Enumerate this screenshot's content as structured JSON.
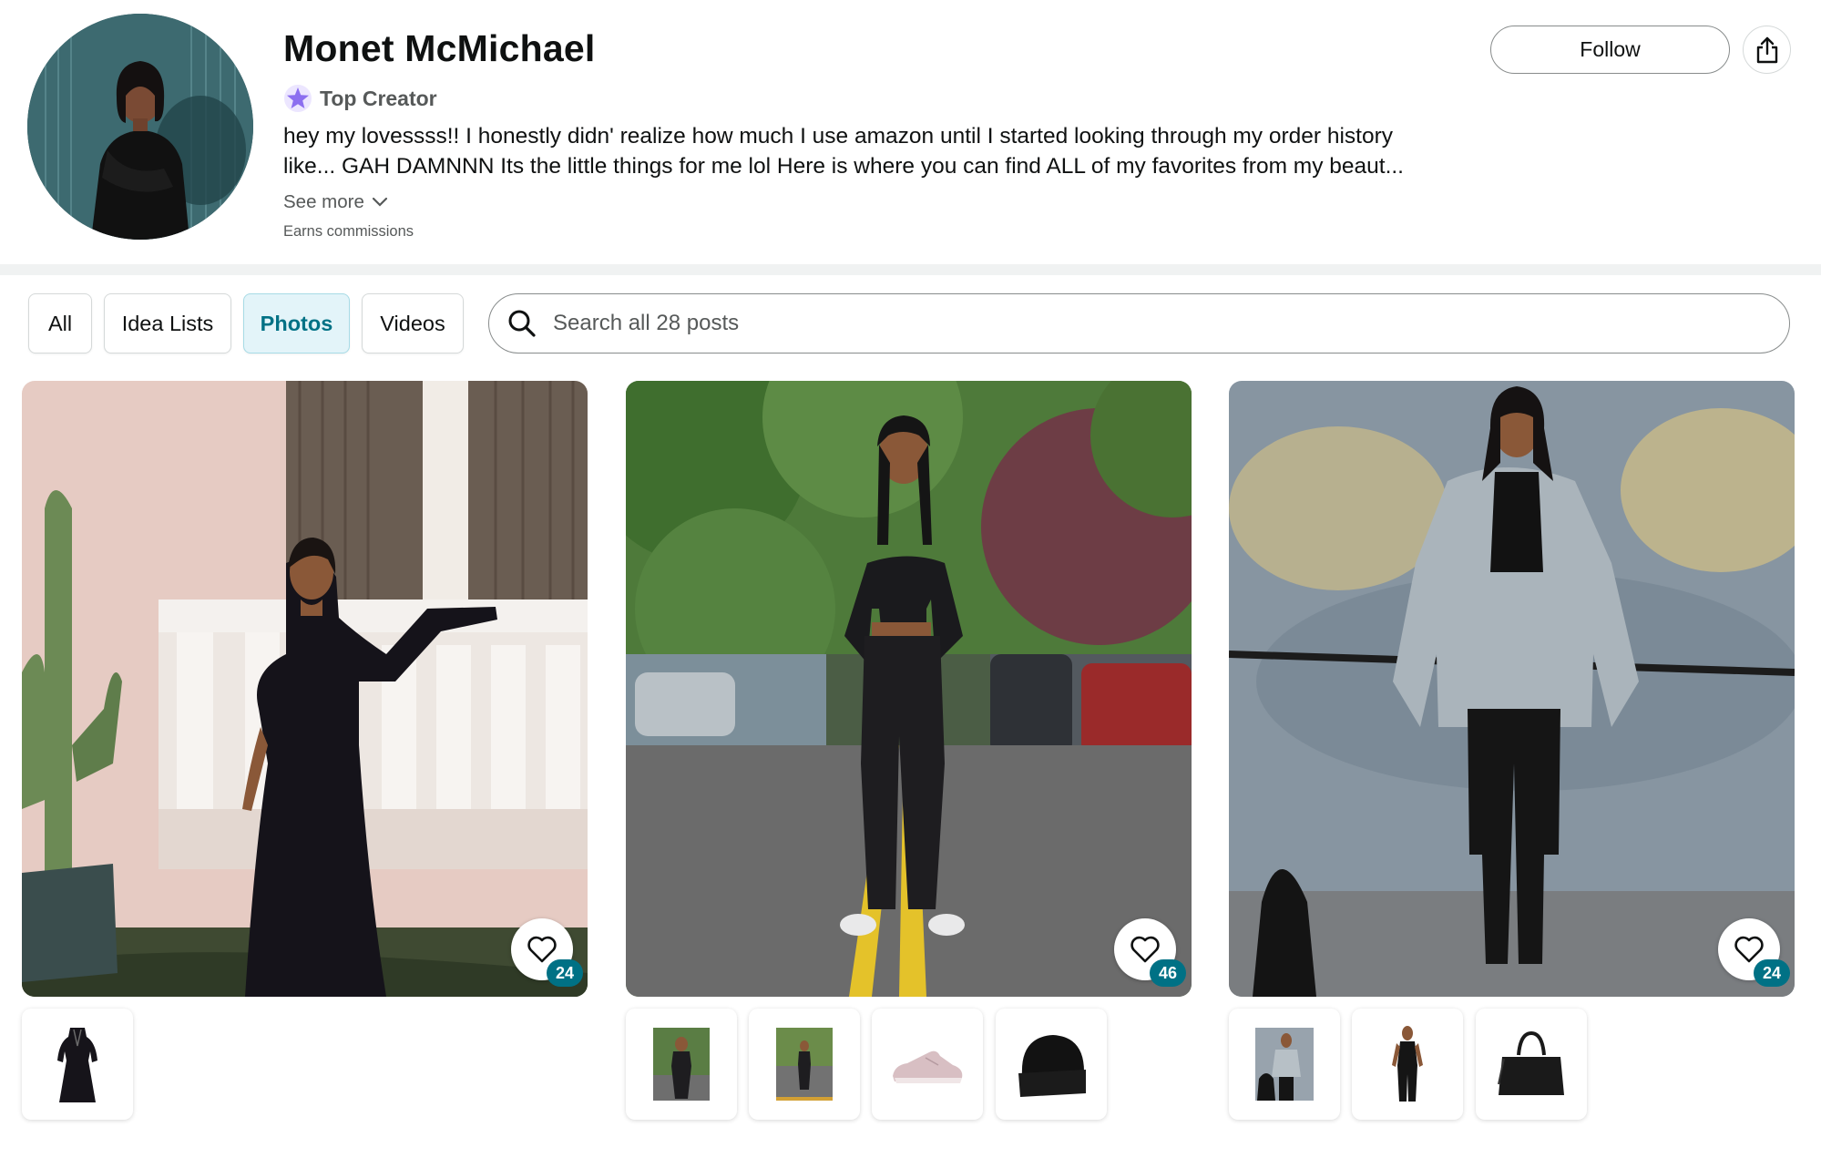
{
  "profile": {
    "name": "Monet McMichael",
    "badge": "Top Creator",
    "bio_line1": "hey my lovessss!! I honestly didn' realize how much I use amazon until I started looking through my order history",
    "bio_line2": "like... GAH DAMNNN Its the little things for me lol Here is where you can find ALL of my favorites from my beaut...",
    "see_more": "See more",
    "earns": "Earns commissions",
    "follow_label": "Follow",
    "avatar_icon": "profile-photo"
  },
  "filters": {
    "tabs": [
      {
        "label": "All",
        "active": false
      },
      {
        "label": "Idea Lists",
        "active": false
      },
      {
        "label": "Photos",
        "active": true
      },
      {
        "label": "Videos",
        "active": false
      }
    ],
    "search_placeholder": "Search all 28 posts"
  },
  "posts": [
    {
      "likes": "24",
      "thumbnails": [
        "black-dress"
      ]
    },
    {
      "likes": "46",
      "thumbnails": [
        "outfit-photo",
        "outfit-photo-street",
        "pink-sneaker",
        "black-beanie"
      ]
    },
    {
      "likes": "24",
      "thumbnails": [
        "outfit-photo-jacket",
        "black-jumpsuit",
        "black-tote-bag"
      ]
    }
  ],
  "colors": {
    "accent_teal": "#007185",
    "active_chip_bg": "#e3f4f9",
    "badge_star": "#8c6ff0"
  }
}
